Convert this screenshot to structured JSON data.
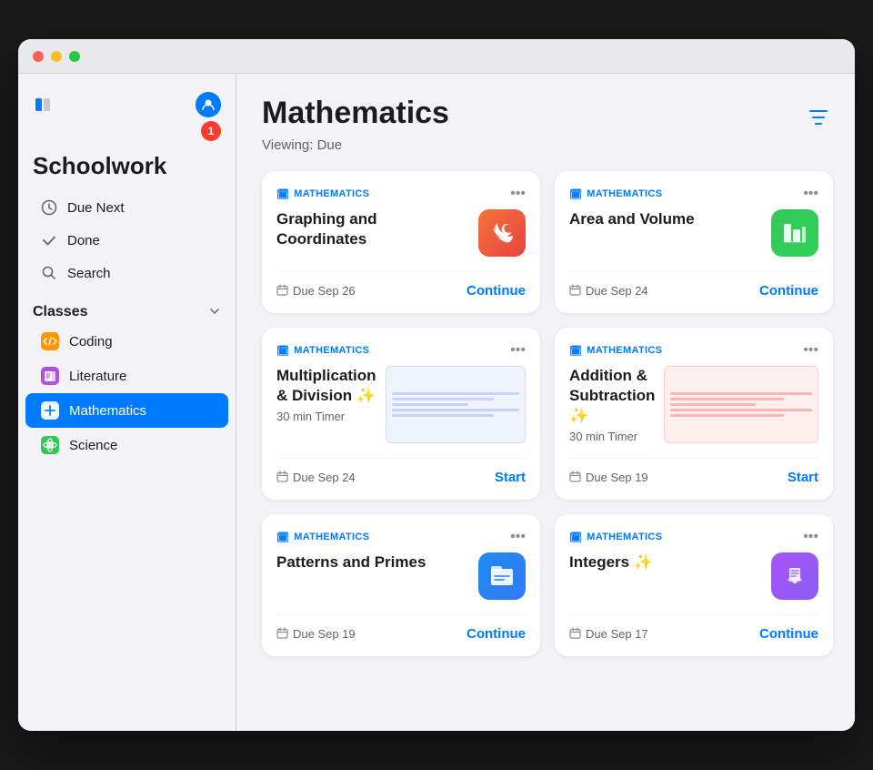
{
  "window": {
    "title": "Schoolwork"
  },
  "sidebar": {
    "app_title": "Schoolwork",
    "nav_items": [
      {
        "id": "due-next",
        "label": "Due Next",
        "icon": "⏱",
        "badge": "1"
      },
      {
        "id": "done",
        "label": "Done",
        "icon": "✓",
        "badge": null
      },
      {
        "id": "search",
        "label": "Search",
        "icon": "🔍",
        "badge": null
      }
    ],
    "classes_section_title": "Classes",
    "classes": [
      {
        "id": "coding",
        "label": "Coding",
        "icon": "coding",
        "active": false
      },
      {
        "id": "literature",
        "label": "Literature",
        "icon": "literature",
        "active": false
      },
      {
        "id": "mathematics",
        "label": "Mathematics",
        "icon": "mathematics",
        "active": true
      },
      {
        "id": "science",
        "label": "Science",
        "icon": "science",
        "active": false
      }
    ]
  },
  "main": {
    "page_title": "Mathematics",
    "viewing_label": "Viewing: Due",
    "filter_icon_label": "filter",
    "assignments": [
      {
        "id": "graphing",
        "subject": "MATHEMATICS",
        "title": "Graphing and Coordinates",
        "subtitle": "",
        "app_type": "swift",
        "due_date": "Due Sep 26",
        "action": "Continue",
        "action_type": "continue"
      },
      {
        "id": "area-volume",
        "subject": "MATHEMATICS",
        "title": "Area and Volume",
        "subtitle": "",
        "app_type": "numbers",
        "due_date": "Due Sep 24",
        "action": "Continue",
        "action_type": "continue"
      },
      {
        "id": "multiplication",
        "subject": "MATHEMATICS",
        "title": "Multiplication & Division ✨",
        "subtitle": "30 min Timer",
        "app_type": "thumbnail",
        "due_date": "Due Sep 24",
        "action": "Start",
        "action_type": "start"
      },
      {
        "id": "addition",
        "subject": "MATHEMATICS",
        "title": "Addition & Subtraction ✨",
        "subtitle": "30 min Timer",
        "app_type": "thumbnail2",
        "due_date": "Due Sep 19",
        "action": "Start",
        "action_type": "start"
      },
      {
        "id": "patterns",
        "subject": "MATHEMATICS",
        "title": "Patterns and Primes",
        "subtitle": "",
        "app_type": "files",
        "due_date": "Due Sep 19",
        "action": "Continue",
        "action_type": "continue"
      },
      {
        "id": "integers",
        "subject": "MATHEMATICS",
        "title": "Integers ✨",
        "subtitle": "",
        "app_type": "keynote",
        "due_date": "Due Sep 17",
        "action": "Continue",
        "action_type": "continue"
      }
    ]
  },
  "icons": {
    "sidebar_toggle": "⊞",
    "profile": "👤",
    "chevron_down": "⌄",
    "more": "•••",
    "calendar": "📅",
    "filter": "⊟"
  }
}
